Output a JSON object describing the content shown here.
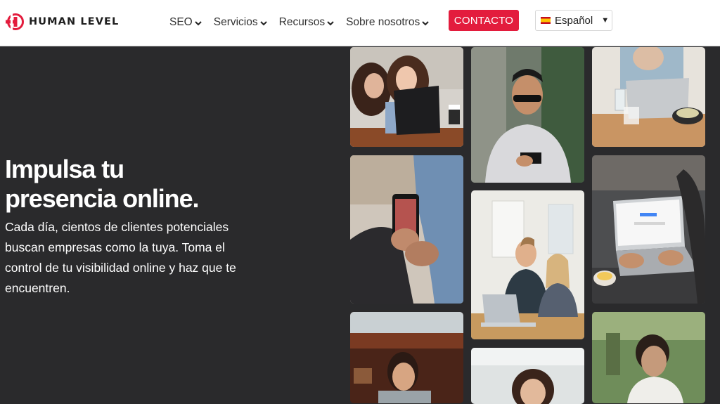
{
  "header": {
    "logo_text": "HUMAN LEVEL",
    "nav": [
      {
        "label": "SEO"
      },
      {
        "label": "Servicios"
      },
      {
        "label": "Recursos"
      },
      {
        "label": "Sobre nosotros"
      }
    ],
    "cta_label": "CONTACTO",
    "language": {
      "selected": "Español",
      "flag_icon": "spain-flag-icon"
    }
  },
  "hero": {
    "title_line1": "Impulsa tu",
    "title_line2": "presencia online.",
    "description": "Cada día, cientos de clientes potenciales buscan empresas como la tuya. Toma el control de tu visibilidad online y haz que te encuentren."
  },
  "colors": {
    "brand_red": "#e31c3d",
    "hero_bg": "#2a2a2c",
    "header_bg": "#ffffff"
  }
}
